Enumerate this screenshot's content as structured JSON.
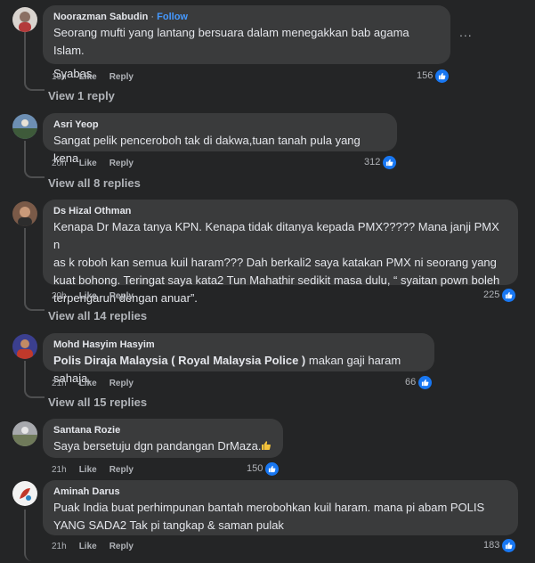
{
  "comments": [
    {
      "author": "Noorazman Sabudin",
      "follow_label": "Follow",
      "lines": [
        "Seorang mufti yang lantang bersuara dalam menegakkan bab agama Islam.",
        "",
        "Syabas."
      ],
      "time": "19h",
      "like_label": "Like",
      "reply_label": "Reply",
      "reactions": "156",
      "view_replies": "View 1 reply",
      "more_label": "..."
    },
    {
      "author": "Asri Yeop",
      "lines": [
        "Sangat pelik penceroboh tak di dakwa,tuan tanah pula yang kena"
      ],
      "time": "20h",
      "like_label": "Like",
      "reply_label": "Reply",
      "reactions": "312",
      "view_replies": "View all 8 replies"
    },
    {
      "author": "Ds Hizal Othman",
      "lines": [
        "Kenapa Dr Maza tanya KPN. Kenapa tidak ditanya kepada PMX????? Mana janji PMX n",
        "as k roboh kan semua kuil haram??? Dah berkali2 saya katakan PMX ni seorang yang",
        "kuat bohong. Teringat saya kata2 Tun Mahathir sedikit masa dulu, “ syaitan pown boleh",
        "terpengaruh dengan anuar”."
      ],
      "time": "20h",
      "like_label": "Like",
      "reply_label": "Reply",
      "reactions": "225",
      "view_replies": "View all 14 replies"
    },
    {
      "author": "Mohd Hasyim Hasyim",
      "tagged": "Polis Diraja Malaysia ( Royal Malaysia Police )",
      "text_after_tag": " makan gaji haram sahaja.",
      "time": "21h",
      "like_label": "Like",
      "reply_label": "Reply",
      "reactions": "66",
      "view_replies": "View all 15 replies"
    },
    {
      "author": "Santana Rozie",
      "lines": [
        "Saya bersetuju dgn pandangan DrMaza."
      ],
      "emoji": "thumbs-up-emoji",
      "time": "21h",
      "like_label": "Like",
      "reply_label": "Reply",
      "reactions": "150"
    },
    {
      "author": "Aminah Darus",
      "lines": [
        "Puak India buat perhimpunan bantah merobohkan kuil haram. mana pi abam POLIS",
        "YANG SADA2 Tak pi tangkap & saman pulak"
      ],
      "time": "21h",
      "like_label": "Like",
      "reply_label": "Reply",
      "reactions": "183"
    }
  ],
  "colors": {
    "background": "#242526",
    "bubble": "#3a3b3c",
    "text": "#e4e6eb",
    "muted": "#b0b3b8",
    "follow": "#4599ff",
    "like_badge": "#1877f2"
  },
  "icons": {
    "reaction": "like-reaction-icon",
    "more": "more-options-icon"
  }
}
